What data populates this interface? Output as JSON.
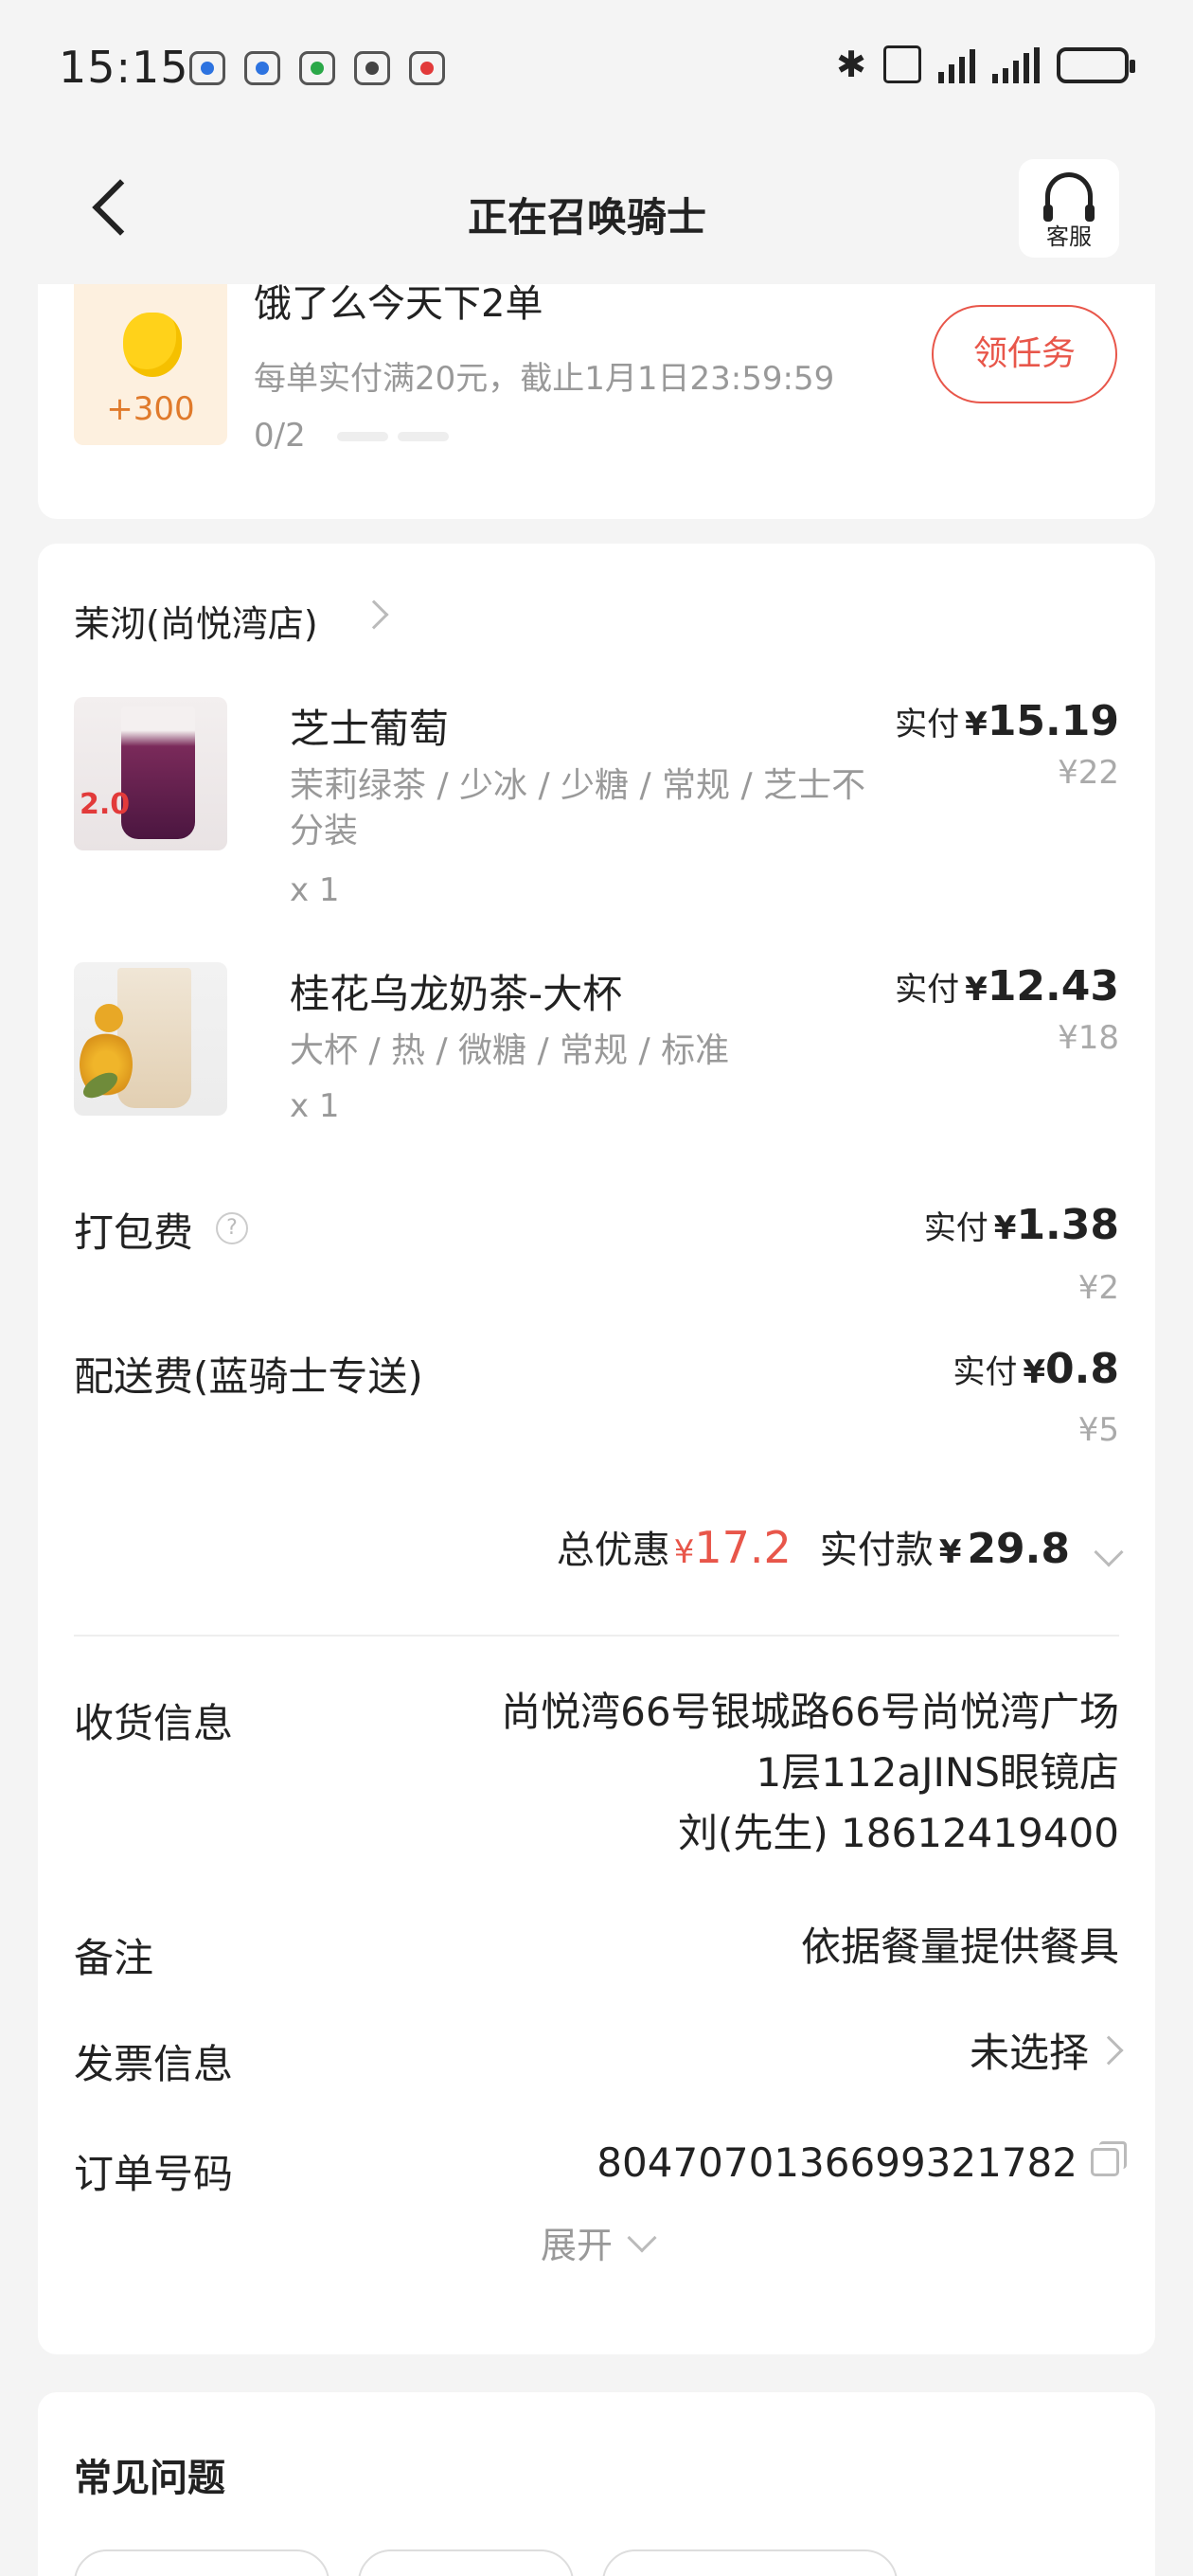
{
  "status_bar": {
    "time": "15:15"
  },
  "header": {
    "title": "正在召唤骑士",
    "service_label": "客服"
  },
  "task": {
    "points": "+300",
    "title": "饿了么今天下2单",
    "desc": "每单实付满20元，截止1月1日23:59:59",
    "progress": "0/2",
    "button": "领任务"
  },
  "order": {
    "shop_name": "茉沏(尚悦湾店)",
    "items": [
      {
        "name": "芝士葡萄",
        "spec": "茉莉绿茶 / 少冰 / 少糖 / 常规 / 芝士不分装",
        "qty": "x 1",
        "paid_label": "实付",
        "currency": "¥",
        "paid": "15.19",
        "original": "¥22",
        "badge": "2.0"
      },
      {
        "name": "桂花乌龙奶茶-大杯",
        "spec": "大杯 / 热 / 微糖 / 常规 / 标准",
        "qty": "x 1",
        "paid_label": "实付",
        "currency": "¥",
        "paid": "12.43",
        "original": "¥18"
      }
    ],
    "fees": [
      {
        "label": "打包费",
        "paid_label": "实付",
        "currency": "¥",
        "paid": "1.38",
        "original": "¥2"
      },
      {
        "label": "配送费(蓝骑士专送)",
        "paid_label": "实付",
        "currency": "¥",
        "paid": "0.8",
        "original": "¥5"
      }
    ],
    "total": {
      "discount_label": "总优惠",
      "currency": "¥",
      "discount": "17.2",
      "paid_label": "实付款",
      "paid": "29.8"
    },
    "info": {
      "address_label": "收货信息",
      "address_line1": "尚悦湾66号银城路66号尚悦湾广场",
      "address_line2": "1层112aJINS眼镜店",
      "contact": "刘(先生) 18612419400",
      "note_label": "备注",
      "note_value": "依据餐量提供餐具",
      "invoice_label": "发票信息",
      "invoice_value": "未选择",
      "order_no_label": "订单号码",
      "order_no": "8047070136699321782"
    },
    "expand_label": "展开"
  },
  "faq": {
    "title": "常见问题"
  }
}
